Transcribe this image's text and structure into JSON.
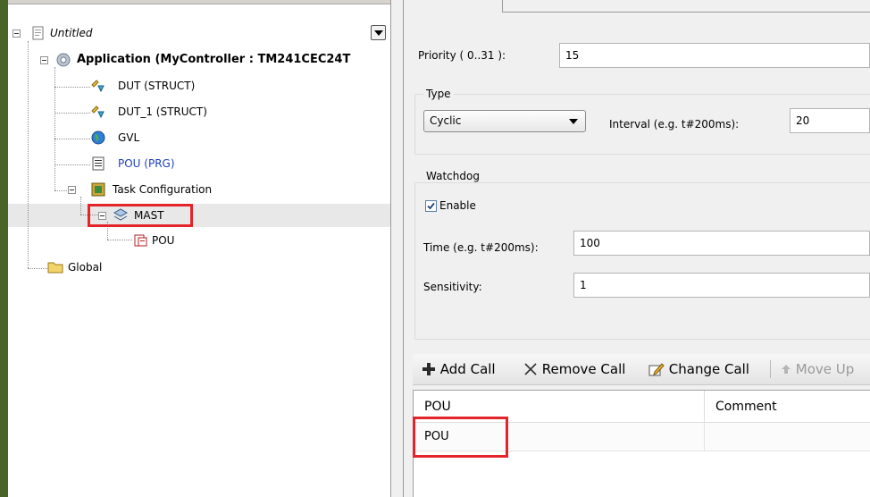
{
  "tree": {
    "root_label": "Untitled",
    "application_label": "Application (MyController : TM241CEC24T",
    "items": [
      {
        "label": "DUT (STRUCT)",
        "icon": "dut-icon"
      },
      {
        "label": "DUT_1 (STRUCT)",
        "icon": "dut-icon"
      },
      {
        "label": "GVL",
        "icon": "globe-icon"
      },
      {
        "label": "POU (PRG)",
        "icon": "pou-document-icon",
        "color": "#1c3fbf"
      },
      {
        "label": "Task Configuration",
        "icon": "task-configuration-icon"
      }
    ],
    "mast_label": "MAST",
    "pou_call_label": "POU",
    "global_label": "Global",
    "highlight_color": "#e3242b"
  },
  "task": {
    "priority_label": "Priority ( 0..31 ):",
    "priority_value": "15",
    "type_group": "Type",
    "type_value": "Cyclic",
    "interval_label": "Interval (e.g. t#200ms):",
    "interval_value": "20",
    "watchdog_group": "Watchdog",
    "enable_label": "Enable",
    "enable_checked": true,
    "time_label": "Time (e.g. t#200ms):",
    "time_value": "100",
    "sensitivity_label": "Sensitivity:",
    "sensitivity_value": "1"
  },
  "toolbar": {
    "add_call": "Add Call",
    "remove_call": "Remove Call",
    "change_call": "Change Call",
    "move_up": "Move Up"
  },
  "grid": {
    "columns": [
      "POU",
      "Comment"
    ],
    "rows": [
      [
        "POU",
        ""
      ]
    ]
  }
}
